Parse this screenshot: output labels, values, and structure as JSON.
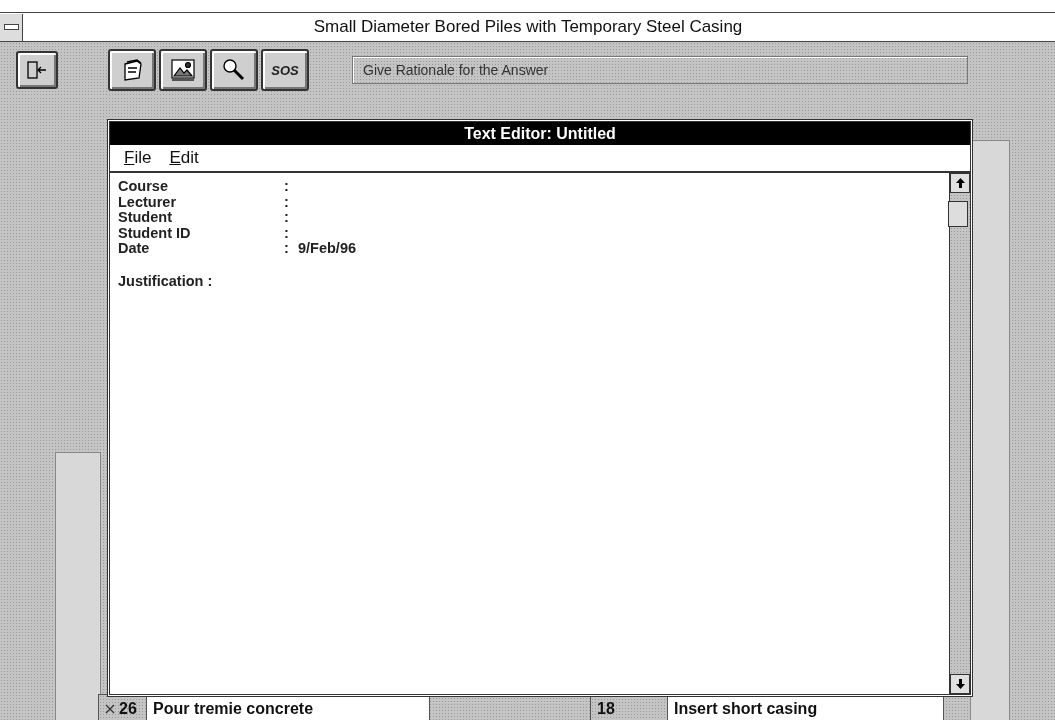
{
  "window": {
    "title": "Small Diameter Bored Piles with Temporary Steel Casing"
  },
  "toolbar": {
    "buttons": [
      {
        "kind": "exit"
      },
      {
        "kind": "notepad"
      },
      {
        "kind": "picture"
      },
      {
        "kind": "search"
      },
      {
        "kind": "sos",
        "label": "SOS"
      }
    ],
    "hint": "Give Rationale for the Answer"
  },
  "editor": {
    "title": "Text Editor: Untitled",
    "menu": [
      {
        "label": "File"
      },
      {
        "label": "Edit"
      }
    ],
    "fields": [
      {
        "label": "Course",
        "colon": ":"
      },
      {
        "label": "Lecturer",
        "colon": ":"
      },
      {
        "label": "Student",
        "colon": ":"
      },
      {
        "label": "Student ID",
        "colon": ":"
      },
      {
        "label": "Date",
        "colon": ":",
        "value": "9/Feb/96"
      }
    ],
    "justification": "Justification :"
  },
  "steps": [
    {
      "number": "26",
      "label": "Pour tremie concrete",
      "marked": true
    },
    {
      "number": "18",
      "label": "Insert short casing",
      "marked": false
    }
  ]
}
